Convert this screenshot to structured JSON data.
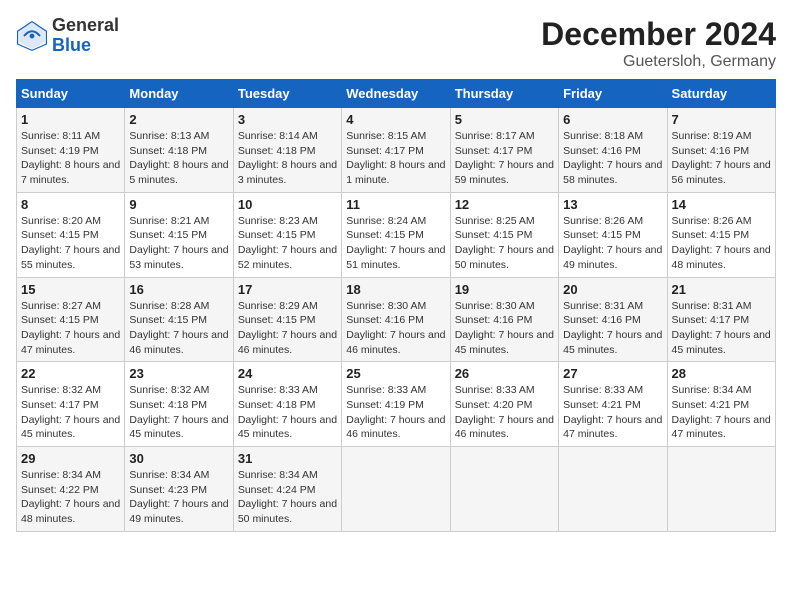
{
  "header": {
    "logo_general": "General",
    "logo_blue": "Blue",
    "title": "December 2024",
    "subtitle": "Guetersloh, Germany"
  },
  "columns": [
    "Sunday",
    "Monday",
    "Tuesday",
    "Wednesday",
    "Thursday",
    "Friday",
    "Saturday"
  ],
  "weeks": [
    [
      {
        "day": "1",
        "sunrise": "Sunrise: 8:11 AM",
        "sunset": "Sunset: 4:19 PM",
        "daylight": "Daylight: 8 hours and 7 minutes."
      },
      {
        "day": "2",
        "sunrise": "Sunrise: 8:13 AM",
        "sunset": "Sunset: 4:18 PM",
        "daylight": "Daylight: 8 hours and 5 minutes."
      },
      {
        "day": "3",
        "sunrise": "Sunrise: 8:14 AM",
        "sunset": "Sunset: 4:18 PM",
        "daylight": "Daylight: 8 hours and 3 minutes."
      },
      {
        "day": "4",
        "sunrise": "Sunrise: 8:15 AM",
        "sunset": "Sunset: 4:17 PM",
        "daylight": "Daylight: 8 hours and 1 minute."
      },
      {
        "day": "5",
        "sunrise": "Sunrise: 8:17 AM",
        "sunset": "Sunset: 4:17 PM",
        "daylight": "Daylight: 7 hours and 59 minutes."
      },
      {
        "day": "6",
        "sunrise": "Sunrise: 8:18 AM",
        "sunset": "Sunset: 4:16 PM",
        "daylight": "Daylight: 7 hours and 58 minutes."
      },
      {
        "day": "7",
        "sunrise": "Sunrise: 8:19 AM",
        "sunset": "Sunset: 4:16 PM",
        "daylight": "Daylight: 7 hours and 56 minutes."
      }
    ],
    [
      {
        "day": "8",
        "sunrise": "Sunrise: 8:20 AM",
        "sunset": "Sunset: 4:15 PM",
        "daylight": "Daylight: 7 hours and 55 minutes."
      },
      {
        "day": "9",
        "sunrise": "Sunrise: 8:21 AM",
        "sunset": "Sunset: 4:15 PM",
        "daylight": "Daylight: 7 hours and 53 minutes."
      },
      {
        "day": "10",
        "sunrise": "Sunrise: 8:23 AM",
        "sunset": "Sunset: 4:15 PM",
        "daylight": "Daylight: 7 hours and 52 minutes."
      },
      {
        "day": "11",
        "sunrise": "Sunrise: 8:24 AM",
        "sunset": "Sunset: 4:15 PM",
        "daylight": "Daylight: 7 hours and 51 minutes."
      },
      {
        "day": "12",
        "sunrise": "Sunrise: 8:25 AM",
        "sunset": "Sunset: 4:15 PM",
        "daylight": "Daylight: 7 hours and 50 minutes."
      },
      {
        "day": "13",
        "sunrise": "Sunrise: 8:26 AM",
        "sunset": "Sunset: 4:15 PM",
        "daylight": "Daylight: 7 hours and 49 minutes."
      },
      {
        "day": "14",
        "sunrise": "Sunrise: 8:26 AM",
        "sunset": "Sunset: 4:15 PM",
        "daylight": "Daylight: 7 hours and 48 minutes."
      }
    ],
    [
      {
        "day": "15",
        "sunrise": "Sunrise: 8:27 AM",
        "sunset": "Sunset: 4:15 PM",
        "daylight": "Daylight: 7 hours and 47 minutes."
      },
      {
        "day": "16",
        "sunrise": "Sunrise: 8:28 AM",
        "sunset": "Sunset: 4:15 PM",
        "daylight": "Daylight: 7 hours and 46 minutes."
      },
      {
        "day": "17",
        "sunrise": "Sunrise: 8:29 AM",
        "sunset": "Sunset: 4:15 PM",
        "daylight": "Daylight: 7 hours and 46 minutes."
      },
      {
        "day": "18",
        "sunrise": "Sunrise: 8:30 AM",
        "sunset": "Sunset: 4:16 PM",
        "daylight": "Daylight: 7 hours and 46 minutes."
      },
      {
        "day": "19",
        "sunrise": "Sunrise: 8:30 AM",
        "sunset": "Sunset: 4:16 PM",
        "daylight": "Daylight: 7 hours and 45 minutes."
      },
      {
        "day": "20",
        "sunrise": "Sunrise: 8:31 AM",
        "sunset": "Sunset: 4:16 PM",
        "daylight": "Daylight: 7 hours and 45 minutes."
      },
      {
        "day": "21",
        "sunrise": "Sunrise: 8:31 AM",
        "sunset": "Sunset: 4:17 PM",
        "daylight": "Daylight: 7 hours and 45 minutes."
      }
    ],
    [
      {
        "day": "22",
        "sunrise": "Sunrise: 8:32 AM",
        "sunset": "Sunset: 4:17 PM",
        "daylight": "Daylight: 7 hours and 45 minutes."
      },
      {
        "day": "23",
        "sunrise": "Sunrise: 8:32 AM",
        "sunset": "Sunset: 4:18 PM",
        "daylight": "Daylight: 7 hours and 45 minutes."
      },
      {
        "day": "24",
        "sunrise": "Sunrise: 8:33 AM",
        "sunset": "Sunset: 4:18 PM",
        "daylight": "Daylight: 7 hours and 45 minutes."
      },
      {
        "day": "25",
        "sunrise": "Sunrise: 8:33 AM",
        "sunset": "Sunset: 4:19 PM",
        "daylight": "Daylight: 7 hours and 46 minutes."
      },
      {
        "day": "26",
        "sunrise": "Sunrise: 8:33 AM",
        "sunset": "Sunset: 4:20 PM",
        "daylight": "Daylight: 7 hours and 46 minutes."
      },
      {
        "day": "27",
        "sunrise": "Sunrise: 8:33 AM",
        "sunset": "Sunset: 4:21 PM",
        "daylight": "Daylight: 7 hours and 47 minutes."
      },
      {
        "day": "28",
        "sunrise": "Sunrise: 8:34 AM",
        "sunset": "Sunset: 4:21 PM",
        "daylight": "Daylight: 7 hours and 47 minutes."
      }
    ],
    [
      {
        "day": "29",
        "sunrise": "Sunrise: 8:34 AM",
        "sunset": "Sunset: 4:22 PM",
        "daylight": "Daylight: 7 hours and 48 minutes."
      },
      {
        "day": "30",
        "sunrise": "Sunrise: 8:34 AM",
        "sunset": "Sunset: 4:23 PM",
        "daylight": "Daylight: 7 hours and 49 minutes."
      },
      {
        "day": "31",
        "sunrise": "Sunrise: 8:34 AM",
        "sunset": "Sunset: 4:24 PM",
        "daylight": "Daylight: 7 hours and 50 minutes."
      },
      null,
      null,
      null,
      null
    ]
  ]
}
